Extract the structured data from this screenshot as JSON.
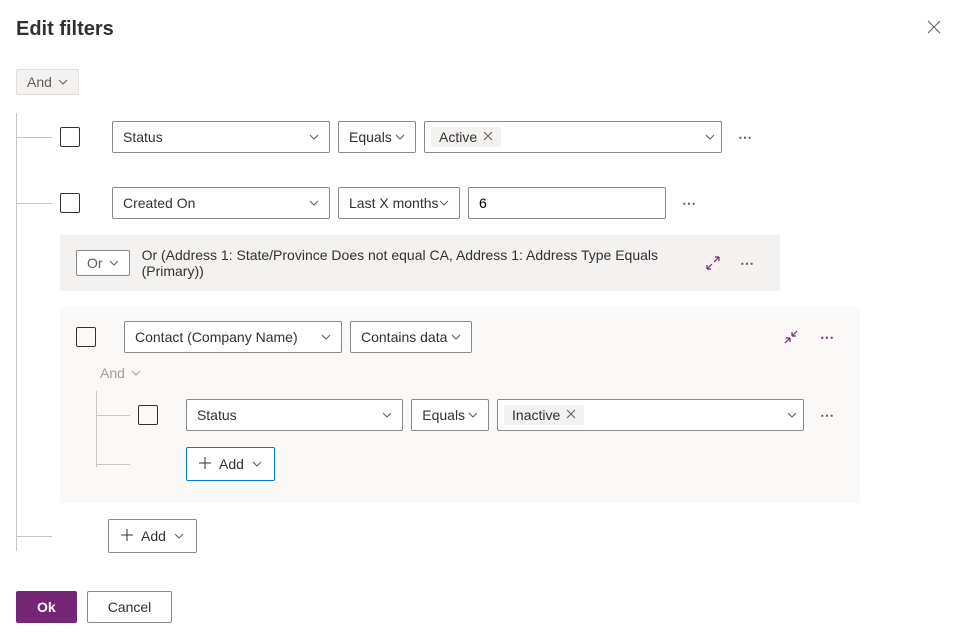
{
  "dialog": {
    "title": "Edit filters"
  },
  "root_operator": "And",
  "conditions": {
    "c1": {
      "field": "Status",
      "operator": "Equals",
      "value_token": "Active"
    },
    "c2": {
      "field": "Created On",
      "operator": "Last X months",
      "value": "6"
    }
  },
  "group": {
    "operator": "Or",
    "summary": "Or (Address 1: State/Province Does not equal CA, Address 1: Address Type Equals (Primary))"
  },
  "related": {
    "entity": "Contact (Company Name)",
    "condition": "Contains data",
    "nested_operator": "And",
    "nested_condition": {
      "field": "Status",
      "operator": "Equals",
      "value_token": "Inactive"
    }
  },
  "buttons": {
    "add": "Add",
    "ok": "Ok",
    "cancel": "Cancel"
  }
}
